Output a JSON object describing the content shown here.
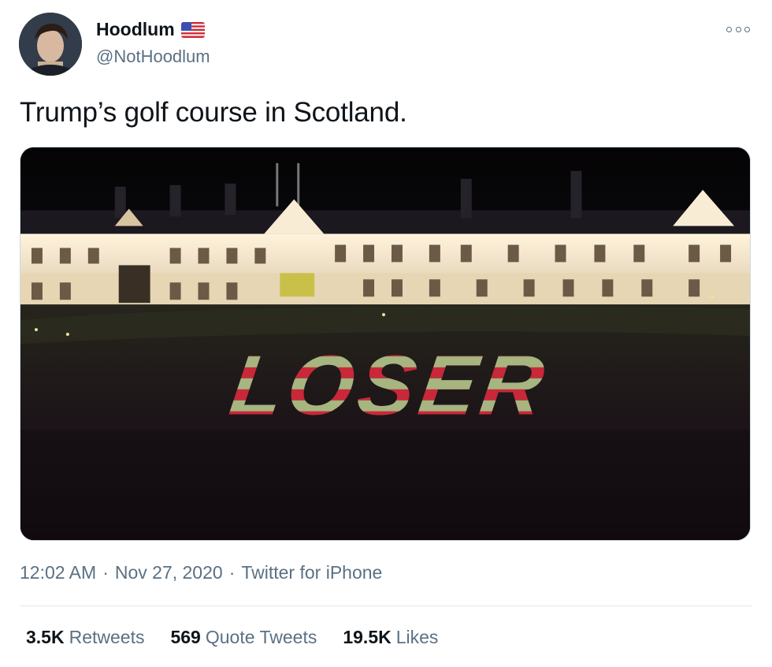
{
  "author": {
    "display_name": "Hoodlum",
    "handle": "@NotHoodlum",
    "avatar_icon": "profile-photo",
    "flag_icon": "us-flag-emoji"
  },
  "tweet": {
    "text": "Trump’s golf course in Scotland.",
    "media_caption_text": "LOSER"
  },
  "meta": {
    "time": "12:02 AM",
    "separator": "·",
    "date": "Nov 27, 2020",
    "source": "Twitter for iPhone"
  },
  "stats": {
    "retweets_count": "3.5K",
    "retweets_label": "Retweets",
    "quotes_count": "569",
    "quotes_label": "Quote Tweets",
    "likes_count": "19.5K",
    "likes_label": "Likes"
  },
  "colors": {
    "text_primary": "#0f1419",
    "text_secondary": "#5b7083",
    "flag_blue": "#3b4fb0",
    "flag_red": "#d1232f",
    "flag_white": "#f3f1e4"
  }
}
